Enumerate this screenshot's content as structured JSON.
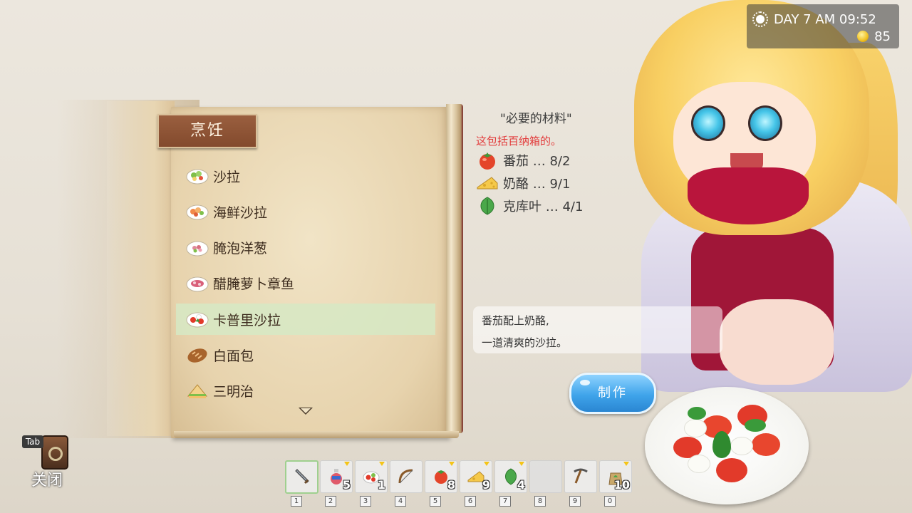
{
  "hud": {
    "day_time": "DAY 7 AM 09:52",
    "gold": "85",
    "sun_icon": "sun-icon",
    "coin_icon": "coin-icon"
  },
  "book": {
    "title": "烹饪",
    "recipes": [
      {
        "label": "沙拉",
        "icon": "salad-icon"
      },
      {
        "label": "海鲜沙拉",
        "icon": "seafood-salad-icon"
      },
      {
        "label": "腌泡洋葱",
        "icon": "pickled-onion-icon"
      },
      {
        "label": "醋腌萝卜章鱼",
        "icon": "pickled-radish-octopus-icon"
      },
      {
        "label": "卡普里沙拉",
        "icon": "caprese-salad-icon",
        "selected": true
      },
      {
        "label": "白面包",
        "icon": "bread-icon"
      },
      {
        "label": "三明治",
        "icon": "sandwich-icon"
      }
    ]
  },
  "materials": {
    "title": "\"必要的材料\"",
    "note": "这包括百纳箱的。",
    "items": [
      {
        "label": "番茄 … 8/2",
        "icon": "tomato-icon"
      },
      {
        "label": "奶酪 … 9/1",
        "icon": "cheese-icon"
      },
      {
        "label": "克库叶 … 4/1",
        "icon": "leaf-icon"
      }
    ]
  },
  "description": {
    "line1": "番茄配上奶酪,",
    "line2": "一道清爽的沙拉。"
  },
  "make_button": {
    "label": "制作"
  },
  "close": {
    "key": "Tab",
    "label": "关闭"
  },
  "hotbar": {
    "slots": [
      {
        "key": "1",
        "icon": "sword-icon",
        "count": ""
      },
      {
        "key": "2",
        "icon": "potion-icon",
        "count": "5"
      },
      {
        "key": "3",
        "icon": "salad-icon",
        "count": "1"
      },
      {
        "key": "4",
        "icon": "bow-icon",
        "count": ""
      },
      {
        "key": "5",
        "icon": "tomato-icon",
        "count": "8"
      },
      {
        "key": "6",
        "icon": "cheese-icon",
        "count": "9"
      },
      {
        "key": "7",
        "icon": "leaf-icon",
        "count": "4"
      },
      {
        "key": "8",
        "icon": "empty-slot",
        "count": ""
      },
      {
        "key": "9",
        "icon": "pickaxe-icon",
        "count": ""
      },
      {
        "key": "0",
        "icon": "seed-bag-icon",
        "count": "10"
      }
    ]
  },
  "colors": {
    "accent_red": "#e23a3a",
    "title_brown": "#834a2d",
    "button_blue": "#3fa4ea",
    "selected_row": "#d6e9c4"
  }
}
